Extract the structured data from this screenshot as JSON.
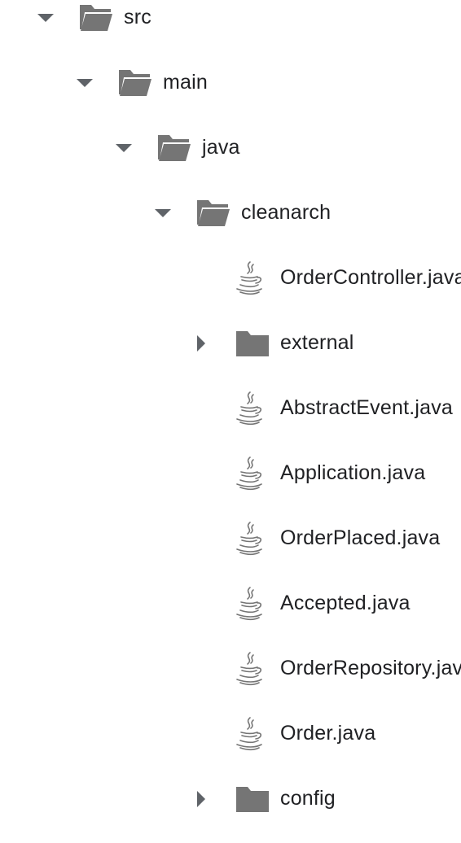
{
  "tree": {
    "nodes": [
      {
        "label": "src",
        "kind": "folder",
        "state": "open",
        "depth": 0
      },
      {
        "label": "main",
        "kind": "folder",
        "state": "open",
        "depth": 1
      },
      {
        "label": "java",
        "kind": "folder",
        "state": "open",
        "depth": 2
      },
      {
        "label": "cleanarch",
        "kind": "folder",
        "state": "open",
        "depth": 3
      },
      {
        "label": "OrderController.java",
        "kind": "java",
        "state": "none",
        "depth": 4
      },
      {
        "label": "external",
        "kind": "folder",
        "state": "closed",
        "depth": 4
      },
      {
        "label": "AbstractEvent.java",
        "kind": "java",
        "state": "none",
        "depth": 4
      },
      {
        "label": "Application.java",
        "kind": "java",
        "state": "none",
        "depth": 4
      },
      {
        "label": "OrderPlaced.java",
        "kind": "java",
        "state": "none",
        "depth": 4
      },
      {
        "label": "Accepted.java",
        "kind": "java",
        "state": "none",
        "depth": 4
      },
      {
        "label": "OrderRepository.java",
        "kind": "java",
        "state": "none",
        "depth": 4
      },
      {
        "label": "Order.java",
        "kind": "java",
        "state": "none",
        "depth": 4
      },
      {
        "label": "config",
        "kind": "folder",
        "state": "closed",
        "depth": 4
      }
    ],
    "icons": {
      "folder_open": "folder-open-icon",
      "folder_closed": "folder-icon",
      "java": "java-file-icon",
      "expanded": "chevron-down-icon",
      "collapsed": "chevron-right-icon"
    },
    "colors": {
      "icon": "#757575",
      "chevron": "#5f6368",
      "text": "#202124"
    }
  }
}
